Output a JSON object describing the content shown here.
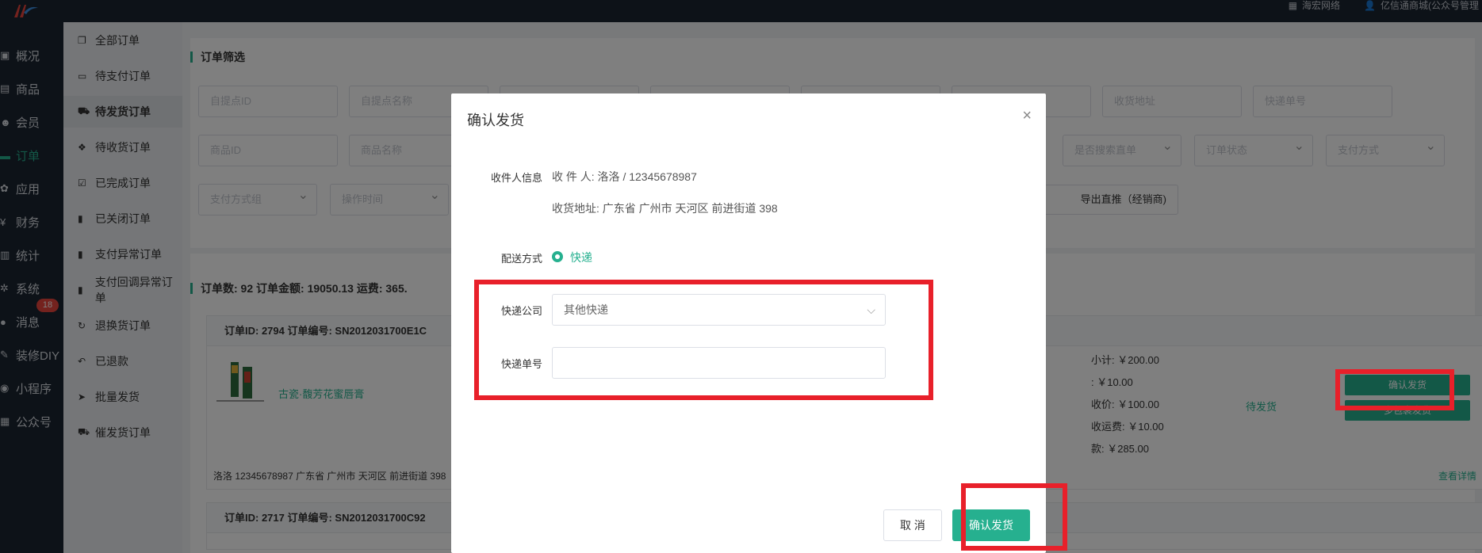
{
  "topbar": {
    "right_items": [
      "海宏网络",
      "亿信通商城(公众号管理"
    ]
  },
  "leftnav": {
    "items": [
      {
        "label": "概况",
        "icon": "dashboard-icon"
      },
      {
        "label": "商品",
        "icon": "goods-icon"
      },
      {
        "label": "会员",
        "icon": "members-icon"
      },
      {
        "label": "订单",
        "icon": "orders-icon",
        "active": true
      },
      {
        "label": "应用",
        "icon": "apps-icon"
      },
      {
        "label": "财务",
        "icon": "finance-icon"
      },
      {
        "label": "统计",
        "icon": "stats-icon"
      },
      {
        "label": "系统",
        "icon": "system-icon"
      },
      {
        "label": "消息",
        "icon": "message-icon",
        "badge": "18"
      },
      {
        "label": "装修DIY",
        "icon": "diy-icon"
      },
      {
        "label": "小程序",
        "icon": "miniprogram-icon"
      },
      {
        "label": "公众号",
        "icon": "official-account-icon"
      }
    ]
  },
  "subnav": {
    "items": [
      {
        "label": "全部订单",
        "icon": "copy-icon"
      },
      {
        "label": "待支付订单",
        "icon": "card-icon"
      },
      {
        "label": "待发货订单",
        "icon": "truck-icon",
        "active": true
      },
      {
        "label": "待收货订单",
        "icon": "box-icon"
      },
      {
        "label": "已完成订单",
        "icon": "check-square-icon"
      },
      {
        "label": "已关闭订单",
        "icon": "trash-icon"
      },
      {
        "label": "支付异常订单",
        "icon": "trash-icon"
      },
      {
        "label": "支付回调异常订单",
        "icon": "trash-icon"
      },
      {
        "label": "退换货订单",
        "icon": "refresh-icon"
      },
      {
        "label": "已退款",
        "icon": "undo-icon"
      },
      {
        "label": "批量发货",
        "icon": "send-icon"
      },
      {
        "label": "催发货订单",
        "icon": "truck-icon"
      }
    ]
  },
  "filter": {
    "title": "订单筛选",
    "row1": [
      "自提点ID",
      "自提点名称",
      "",
      "",
      "",
      "",
      "收货地址",
      "快递单号"
    ],
    "row2": [
      "商品ID",
      "商品名称",
      "是否搜索直单",
      "订单状态",
      "支付方式"
    ],
    "row3": [
      "支付方式组",
      "操作时间"
    ],
    "export_label": "导出直推（经销商)"
  },
  "orders": {
    "stats": "订单数:  92    订单金额:  19050.13    运费:  365.",
    "order1": {
      "head": "订单ID:  2794    订单编号:  SN2012031700E1C",
      "product_name": "古瓷·馥芳花蜜唇膏",
      "prices": [
        "小计: ￥200.00",
        ": ￥10.00",
        "收价: ￥100.00",
        "收运费: ￥10.00",
        "款: ￥285.00"
      ],
      "status": "待发货",
      "confirm_btn": "确认发货",
      "multi_btn": "多包裹发货",
      "address": "洛洛   12345678987   广东省 广州市 天河区 前进街道 398",
      "detail_link": "查看详情"
    },
    "order2": {
      "head": "订单ID:  2717    订单编号:  SN2012031700C92"
    }
  },
  "modal": {
    "title": "确认发货",
    "close": "×",
    "recipient_label": "收件人信息",
    "recipient": "收 件 人: 洛洛 / 12345678987",
    "address": "收货地址: 广东省 广州市 天河区 前进街道 398",
    "delivery_label": "配送方式",
    "delivery_value": "快递",
    "company_label": "快递公司",
    "company_value": "其他快递",
    "tracking_label": "快递单号",
    "tracking_value": "",
    "cancel": "取 消",
    "confirm": "确认发货"
  },
  "colors": {
    "accent": "#26b08f",
    "topbar": "#1b2431",
    "annotation": "#e8202a"
  }
}
